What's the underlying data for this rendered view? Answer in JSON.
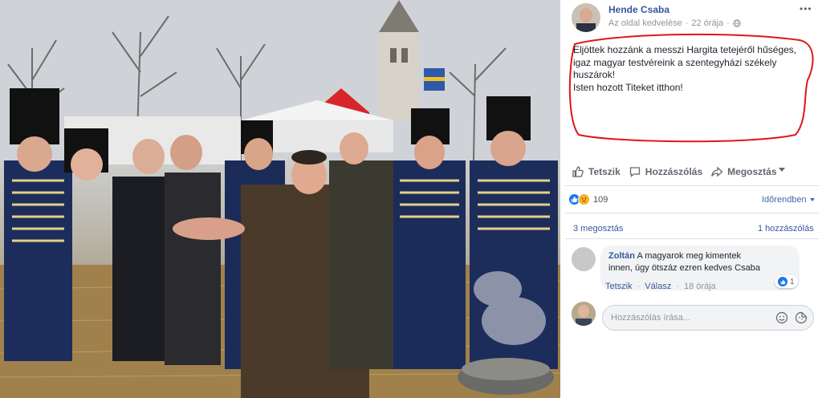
{
  "post": {
    "author": "Hende Csaba",
    "page_like_link": "Az oldal kedvelése",
    "separator": "·",
    "time": "22 órája",
    "more_icon": "ellipsis-icon",
    "text_lines": [
      "Eljöttek hozzánk a messzi Hargita tetejéről hűséges,",
      "igaz magyar testvéreink a szentegyházi székely",
      "huszárok!",
      "Isten hozott Titeket itthon!"
    ],
    "annotation_color": "#e0161b"
  },
  "actions": {
    "like": "Tetszik",
    "comment": "Hozzászólás",
    "share": "Megosztás"
  },
  "reactions": {
    "count": "109",
    "sort_label": "Időrendben"
  },
  "stats": {
    "shares": "3 megosztás",
    "comments": "1 hozzászólás"
  },
  "comment": {
    "name": "Zoltán",
    "text_part1": " A magyarok meg kimentek",
    "text_line2": "innen, úgy ötszáz ezren kedves Csaba",
    "reaction_count": "1",
    "like": "Tetszik",
    "reply": "Válasz",
    "separator": "·",
    "time": "18 órája"
  },
  "composer": {
    "placeholder": "Hozzászólás írása..."
  },
  "colors": {
    "link": "#365899",
    "accent": "#4267b2",
    "like_blue": "#1877f2",
    "sad_yellow": "#f7b125"
  }
}
